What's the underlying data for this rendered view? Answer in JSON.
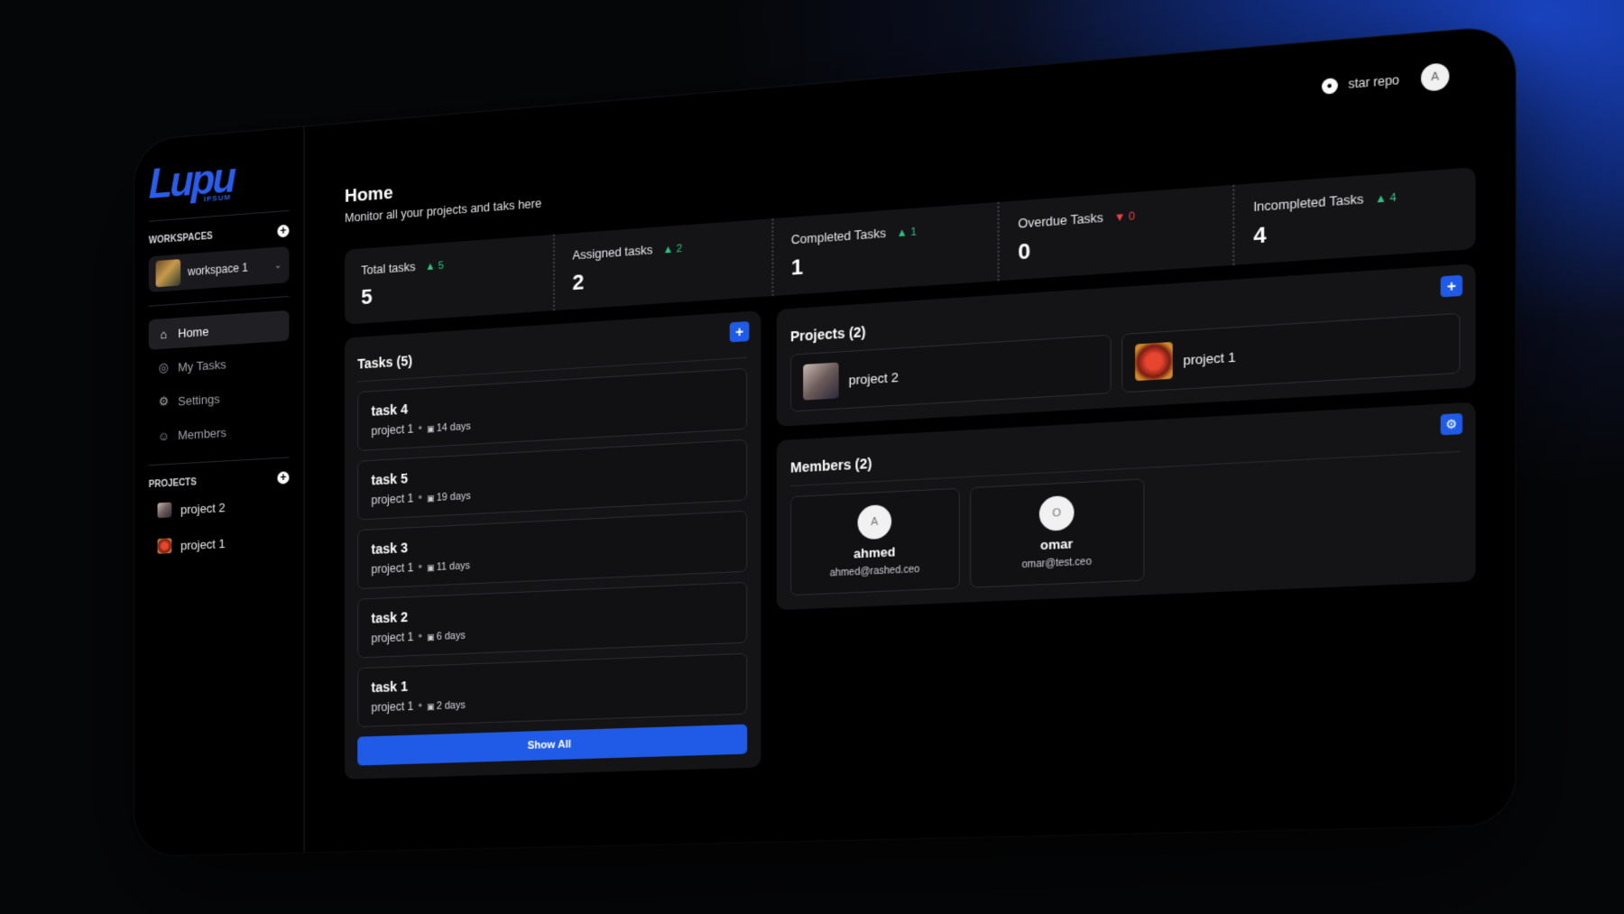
{
  "brand": {
    "logo": "Lupu",
    "logo_sub": "IPSUM"
  },
  "sidebar": {
    "workspaces_label": "WORKSPACES",
    "workspace_selected": "workspace 1",
    "nav": [
      {
        "label": "Home",
        "icon": "home-icon",
        "active": true
      },
      {
        "label": "My Tasks",
        "icon": "check-circle-icon",
        "active": false
      },
      {
        "label": "Settings",
        "icon": "gear-icon",
        "active": false
      },
      {
        "label": "Members",
        "icon": "users-icon",
        "active": false
      }
    ],
    "projects_label": "PROJECTS",
    "projects": [
      {
        "label": "project 2"
      },
      {
        "label": "project 1"
      }
    ]
  },
  "topbar": {
    "star_label": "star repo",
    "avatar_initial": "A"
  },
  "header": {
    "title": "Home",
    "subtitle": "Monitor all your projects and taks here"
  },
  "stats": [
    {
      "label": "Total tasks",
      "delta": "5",
      "trend": "up",
      "value": "5"
    },
    {
      "label": "Assigned tasks",
      "delta": "2",
      "trend": "up",
      "value": "2"
    },
    {
      "label": "Completed Tasks",
      "delta": "1",
      "trend": "up",
      "value": "1"
    },
    {
      "label": "Overdue Tasks",
      "delta": "0",
      "trend": "down",
      "value": "0"
    },
    {
      "label": "Incompleted Tasks",
      "delta": "4",
      "trend": "up",
      "value": "4"
    }
  ],
  "tasks_panel": {
    "title": "Tasks (5)",
    "items": [
      {
        "name": "task 4",
        "project": "project 1",
        "days": "14 days"
      },
      {
        "name": "task 5",
        "project": "project 1",
        "days": "19 days"
      },
      {
        "name": "task 3",
        "project": "project 1",
        "days": "11 days"
      },
      {
        "name": "task 2",
        "project": "project 1",
        "days": "6 days"
      },
      {
        "name": "task 1",
        "project": "project 1",
        "days": "2 days"
      }
    ],
    "show_all": "Show All"
  },
  "projects_panel": {
    "title": "Projects (2)",
    "items": [
      {
        "name": "project 2"
      },
      {
        "name": "project 1"
      }
    ]
  },
  "members_panel": {
    "title": "Members (2)",
    "items": [
      {
        "initial": "A",
        "name": "ahmed",
        "email": "ahmed@rashed.ceo"
      },
      {
        "initial": "O",
        "name": "omar",
        "email": "omar@test.ceo"
      }
    ]
  },
  "colors": {
    "accent": "#1f5be6",
    "up": "#2ec27e",
    "down": "#ef4444"
  }
}
